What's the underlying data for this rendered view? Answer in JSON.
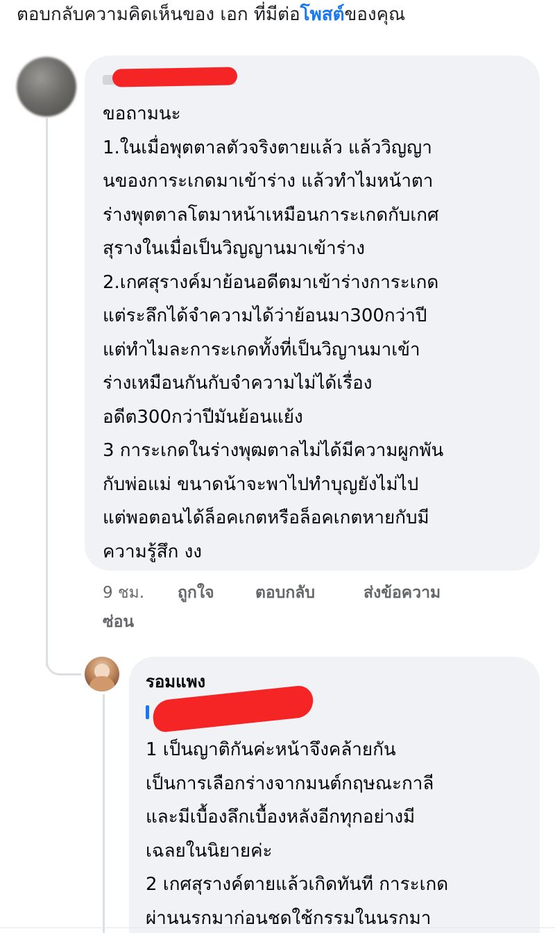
{
  "header": {
    "text_before": "ตอบกลับความคิดเห็นของ เอก ที่มีต่อ",
    "post_link": "โพสต์",
    "text_after": "ของคุณ"
  },
  "comment": {
    "author_name": "",
    "lines": [
      "ขอถามนะ",
      "1.ในเมื่อพุตตาลตัวจริงตายแล้ว แล้ววิญญา",
      "นของการะเกดมาเข้าร่าง แล้วทำไมหน้าตา",
      "ร่างพุตตาลโตมาหน้าเหมือนการะเกดกับเกศ",
      "สุรางในเมื่อเป็นวิญญานมาเข้าร่าง",
      "2.เกศสุรางค์มาย้อนอดีตมาเข้าร่างการะเกด",
      "แต่ระลึกได้จำความได้ว่าย้อนมา300กว่าปี",
      "แต่ทำไมละการะเกดทั้งที่เป็นวิญานมาเข้า",
      "ร่างเหมือนกันกับจำความไม่ได้เรื่อง",
      "อดีต300กว่าปีมันย้อนแย้ง",
      "3 การะเกดในร่างพุฒตาลไม่ได้มีความผูกพัน",
      "กับพ่อแม่ ขนาดน้าจะพาไปทำบุญยังไม่ไป",
      "แต่พอตอนได้ล็อคเกตหรือล็อคเกตหายกับมี",
      "ความรู้สึก งง"
    ],
    "actions": {
      "time": "9 ชม.",
      "like": "ถูกใจ",
      "reply": "ตอบกลับ",
      "message": "ส่งข้อความ",
      "hide": "ซ่อน"
    }
  },
  "reply": {
    "author_name": "รอมแพง",
    "mention": "",
    "lines": [
      "1 เป็นญาติกันค่ะหน้าจึงคล้ายกัน",
      "เป็นการเลือกร่างจากมนต์กฤษณะกาลี",
      "และมีเบื้องลึกเบื้องหลังอีกทุกอย่างมี",
      "เฉลยในนิยายค่ะ",
      "2 เกศสุรางค์ตายแล้วเกิดทันที การะเกด",
      "ผ่านนรกมาก่อนชดใช้กรรมในนรกมา"
    ]
  },
  "colors": {
    "link": "#1877f2",
    "bubble": "#f0f2f5",
    "meta": "#65676b",
    "redaction": "#f52525"
  }
}
